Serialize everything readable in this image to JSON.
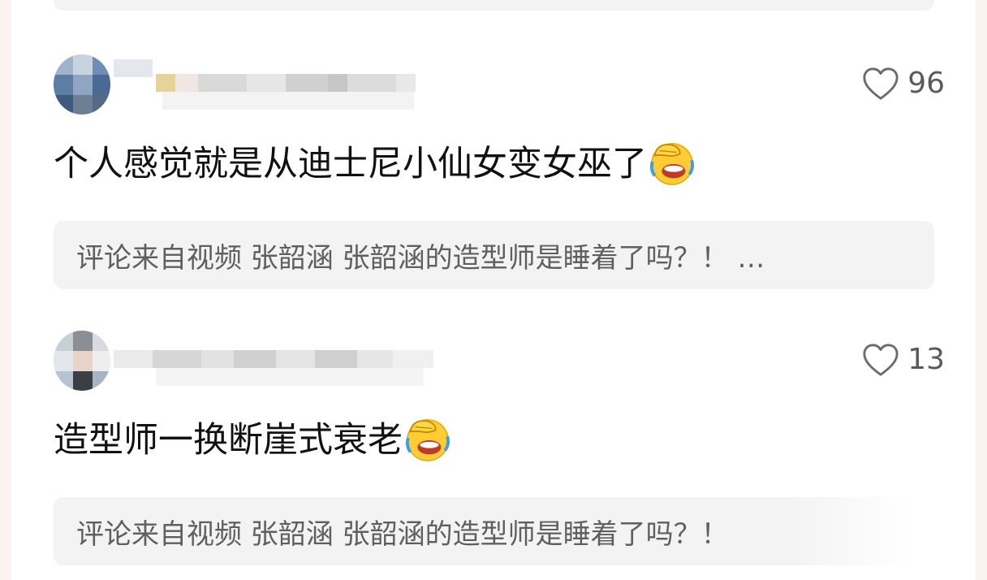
{
  "comments": [
    {
      "likes": "96",
      "text": "个人感觉就是从迪士尼小仙女变女巫了",
      "emoji": "facepalm-laughing-emoji",
      "video_ref": "评论来自视频 张韶涵 张韶涵的造型师是睡着了吗？！ …"
    },
    {
      "likes": "13",
      "text": "造型师一换断崖式衰老",
      "emoji": "facepalm-laughing-emoji",
      "video_ref": "评论来自视频 张韶涵 张韶涵的造型师是睡着了吗？！"
    }
  ],
  "colors": {
    "page_bg": "#fbf3f0",
    "card_bg": "#ffffff",
    "ref_bg": "#f3f3f3",
    "text": "#111111",
    "muted": "#5f5f5f"
  },
  "icons": [
    "heart-outline-icon",
    "facepalm-laughing-emoji"
  ]
}
